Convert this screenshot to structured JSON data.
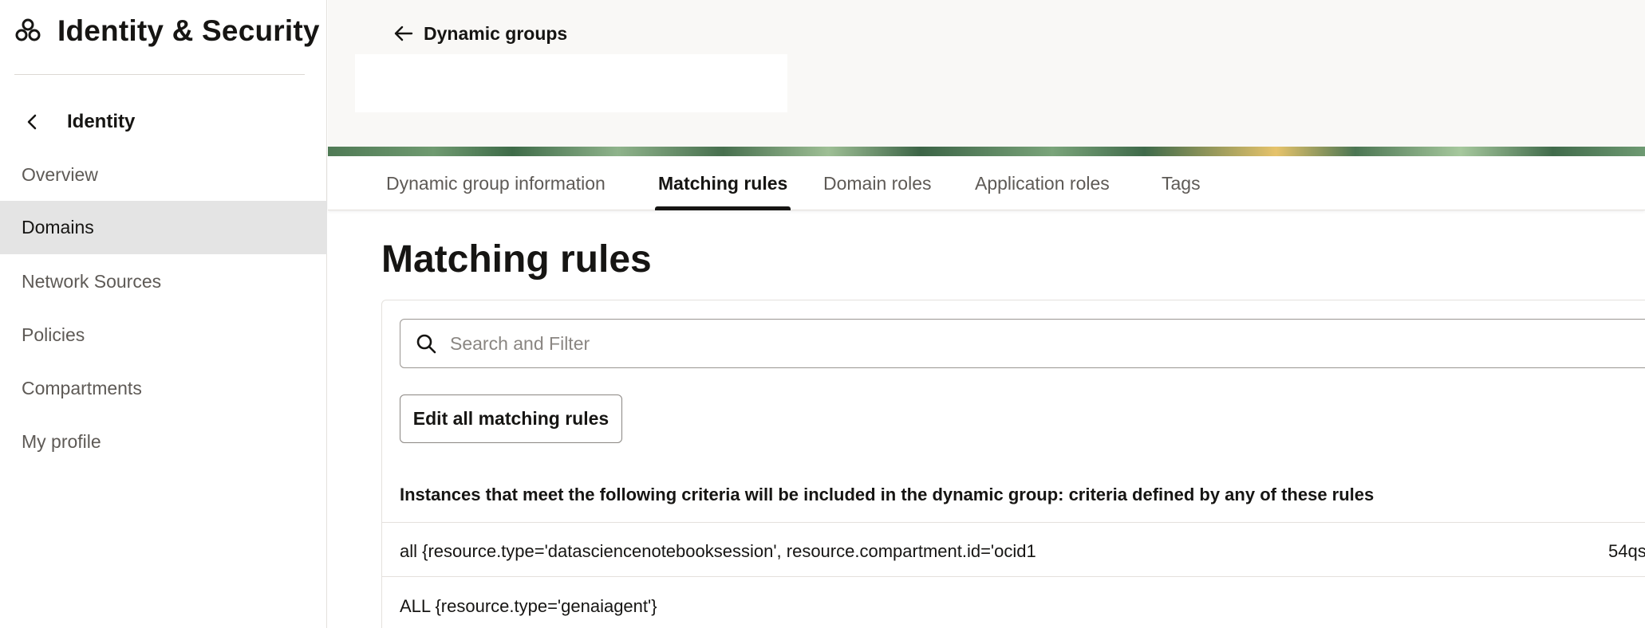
{
  "app": {
    "title": "Identity & Security",
    "logo_icon": "oci-identity-logo-icon"
  },
  "sidebar": {
    "back_label": "Identity",
    "items": [
      {
        "label": "Overview",
        "active": false
      },
      {
        "label": "Domains",
        "active": true
      },
      {
        "label": "Network Sources",
        "active": false
      },
      {
        "label": "Policies",
        "active": false
      },
      {
        "label": "Compartments",
        "active": false
      },
      {
        "label": "My profile",
        "active": false
      }
    ]
  },
  "header": {
    "back_link_label": "Dynamic groups"
  },
  "tabs": [
    {
      "label": "Dynamic group information",
      "active": false
    },
    {
      "label": "Matching rules",
      "active": true
    },
    {
      "label": "Domain roles",
      "active": false
    },
    {
      "label": "Application roles",
      "active": false
    },
    {
      "label": "Tags",
      "active": false
    }
  ],
  "main": {
    "section_title": "Matching rules",
    "search": {
      "placeholder": "Search and Filter",
      "value": ""
    },
    "edit_button_label": "Edit all matching rules",
    "criteria_text": "Instances that meet the following criteria will be included in the dynamic group: criteria defined by any of these rules",
    "rules": [
      {
        "text": "all {resource.type='datasciencenotebooksession', resource.compartment.id='ocid1",
        "trailing": "54qs"
      },
      {
        "text": "ALL {resource.type='genaiagent'}",
        "trailing": ""
      }
    ]
  },
  "colors": {
    "text_primary": "#161513",
    "text_secondary": "#5e5a56",
    "active_nav_bg": "#e4e4e4",
    "top_area_bg": "#f9f8f6",
    "border": "#e4e1dd"
  }
}
